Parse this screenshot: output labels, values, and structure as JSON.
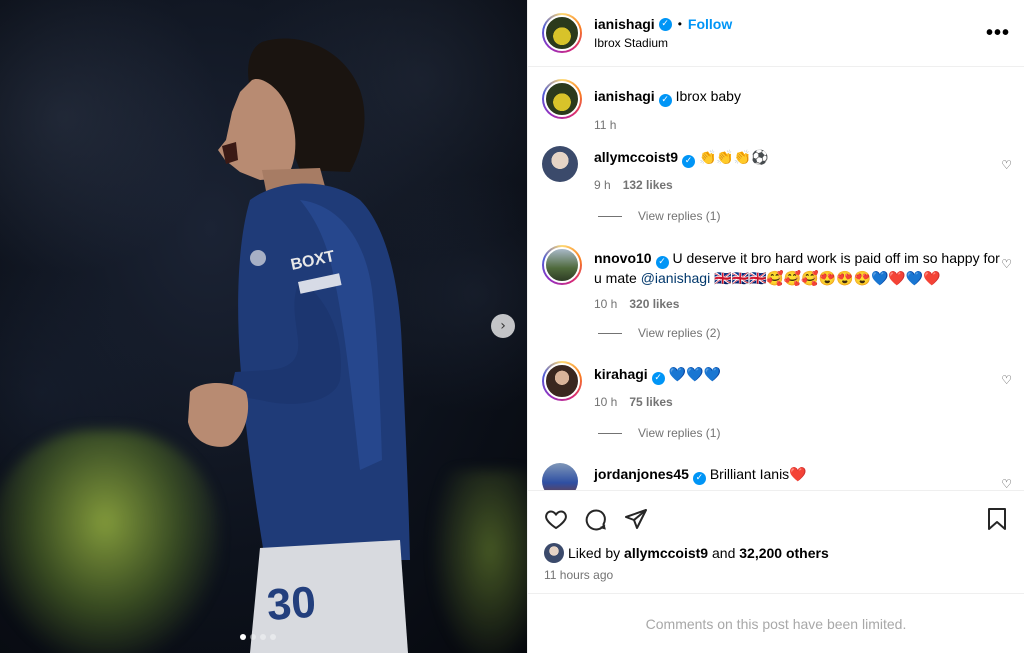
{
  "post": {
    "carousel": {
      "slide_count": 4,
      "active_slide": 1
    },
    "header": {
      "username": "ianishagi",
      "separator": "•",
      "follow_label": "Follow",
      "location": "Ibrox Stadium",
      "more_icon": "more-horizontal-icon"
    },
    "caption": {
      "username": "ianishagi",
      "text": "Ibrox baby",
      "time": "11 h"
    },
    "comments": [
      {
        "username": "ally​mccoist9",
        "text": "👏👏👏⚽",
        "time": "9 h",
        "likes": "132 likes",
        "replies": "View replies (1)"
      },
      {
        "username": "nnovo10",
        "text": "U deserve it bro hard work is paid off im so happy for u mate",
        "mention": "@ianishagi",
        "emoji": " 🇬🇧🇬🇧🇬🇧🥰🥰🥰😍😍😍💙❤️💙❤️",
        "time": "10 h",
        "likes": "320 likes",
        "replies": "View replies (2)"
      },
      {
        "username": "kirahagi",
        "text": "💙💙💙",
        "time": "10 h",
        "likes": "75 likes",
        "replies": "View replies (1)"
      },
      {
        "username": "jordanjones45",
        "text": "Brilliant Ianis❤️"
      }
    ],
    "likes": {
      "prefix": "Liked by",
      "liker": "allymccoist9",
      "conj": "and",
      "others": "32,200 others"
    },
    "posted_ago": "11 hours ago",
    "limited_notice": "Comments on this post have been limited.",
    "verified_mark": "✓",
    "heart_glyph": "♡",
    "next_glyph": "›"
  }
}
